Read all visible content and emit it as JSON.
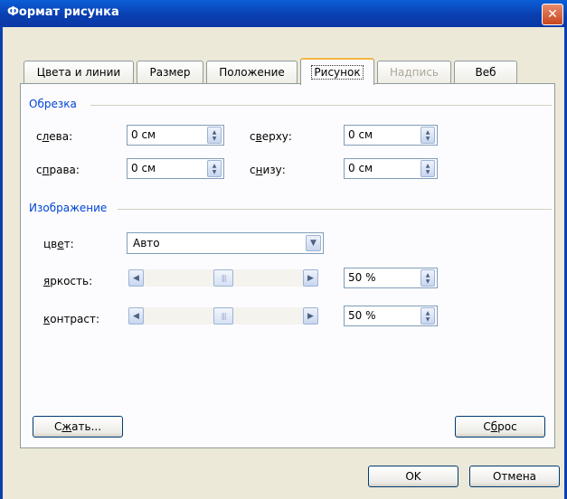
{
  "window": {
    "title": "Формат рисунка",
    "close_glyph": "✕"
  },
  "tabs": [
    {
      "label": "Цвета и линии"
    },
    {
      "label": "Размер"
    },
    {
      "label": "Положение"
    },
    {
      "label": "Рисунок"
    },
    {
      "label": "Надпись"
    },
    {
      "label": "Веб"
    }
  ],
  "crop": {
    "group_label": "Обрезка",
    "left": {
      "label_pre": "с",
      "label_u": "л",
      "label_post": "ева:",
      "value": "0 см"
    },
    "top": {
      "label_pre": "с",
      "label_u": "в",
      "label_post": "ерху:",
      "value": "0 см"
    },
    "right": {
      "label_pre": "с",
      "label_u": "п",
      "label_post": "рава:",
      "value": "0 см"
    },
    "bottom": {
      "label_pre": "с",
      "label_u": "н",
      "label_post": "изу:",
      "value": "0 см"
    }
  },
  "image": {
    "group_label": "Изображение",
    "color": {
      "label_pre": "цв",
      "label_u": "е",
      "label_post": "т:",
      "value": "Авто"
    },
    "brightness": {
      "label_u": "я",
      "label_post": "ркость:",
      "value": "50 %",
      "level": 0.5
    },
    "contrast": {
      "label_u": "к",
      "label_post": "онтраст:",
      "value": "50 %",
      "level": 0.5
    }
  },
  "buttons": {
    "compress_pre": "С",
    "compress_u": "ж",
    "compress_post": "ать...",
    "reset_pre": "С",
    "reset_u": "б",
    "reset_post": "рос",
    "ok": "OK",
    "cancel": "Отмена"
  },
  "icons": {
    "spin": "spinner-arrows",
    "dropdown": "chevron-down-icon",
    "left": "arrow-left-icon",
    "right": "arrow-right-icon"
  }
}
